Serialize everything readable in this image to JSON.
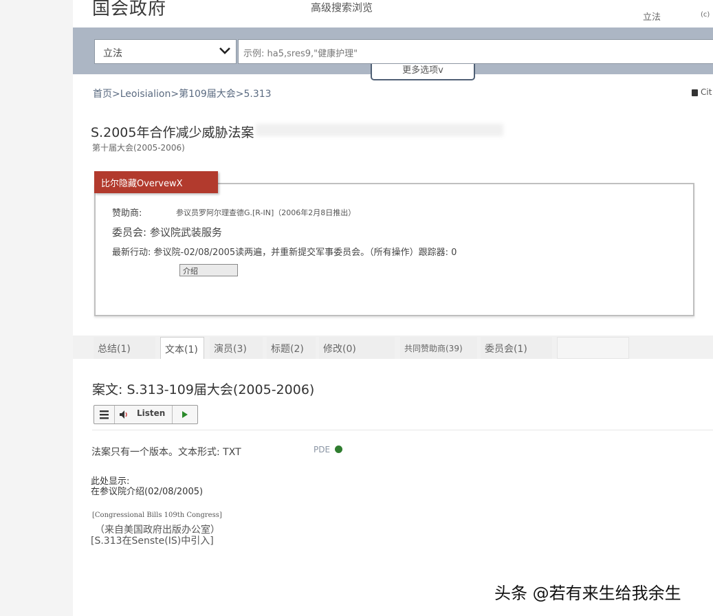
{
  "header": {
    "site_title": "国会政府",
    "advanced_search": "高级搜索浏览",
    "top_link": "立法",
    "top_cut_link": "(c)"
  },
  "search": {
    "select_value": "立法",
    "placeholder": "示例: ha5,sres9,\"健康护理\"",
    "more_options": "更多选项v"
  },
  "breadcrumb": "首页>Leoisialion>第109届大会>5.313",
  "cite_label": "Cit",
  "bill": {
    "title": "S.2005年合作减少威胁法案",
    "congress": "第十届大会(2005-2006)"
  },
  "overview": {
    "tag": "比尔隐藏OvervewX",
    "sponsor_label": "赞助商:",
    "sponsor_value": "参议员罗阿尔理查德G.[R-IN]（2006年2月8日推出）",
    "committee": "委员会: 参议院武装服务",
    "latest_action": "最新行动: 参议院-02/08/2005读两遍，并重新提交军事委员会。（所有操作）跟踪器: 0",
    "intro_button": "介绍"
  },
  "tabs": [
    {
      "label": "总结(1)"
    },
    {
      "label": "文本(1)"
    },
    {
      "label": "演员(3)"
    },
    {
      "label": "标题(2)"
    },
    {
      "label": "修改(0)"
    },
    {
      "label": "共同赞助商(39)"
    },
    {
      "label": "委员会(1)"
    },
    {
      "label": ""
    }
  ],
  "text_section": {
    "heading": "案文: S.313-109届大会(2005-2006)",
    "listen_label": "Listen",
    "version_note": "法案只有一个版本。文本形式: TXT",
    "pdf_label": "PDE",
    "shown_here_1": "此处显示:",
    "shown_here_2": "在参议院介绍(02/08/2005)",
    "congressional_bills": "[Congressional Bills 109th Congress]",
    "gpo": "（来自美国政府出版办公室）",
    "s313_intro": "[S.313在Senste(IS)中引入]"
  },
  "watermark": "头条 @若有来生给我余生",
  "colors": {
    "overview_tag": "#b23a2d",
    "search_band": "#acb6c4",
    "pdf_icon": "#2f7d2f"
  }
}
